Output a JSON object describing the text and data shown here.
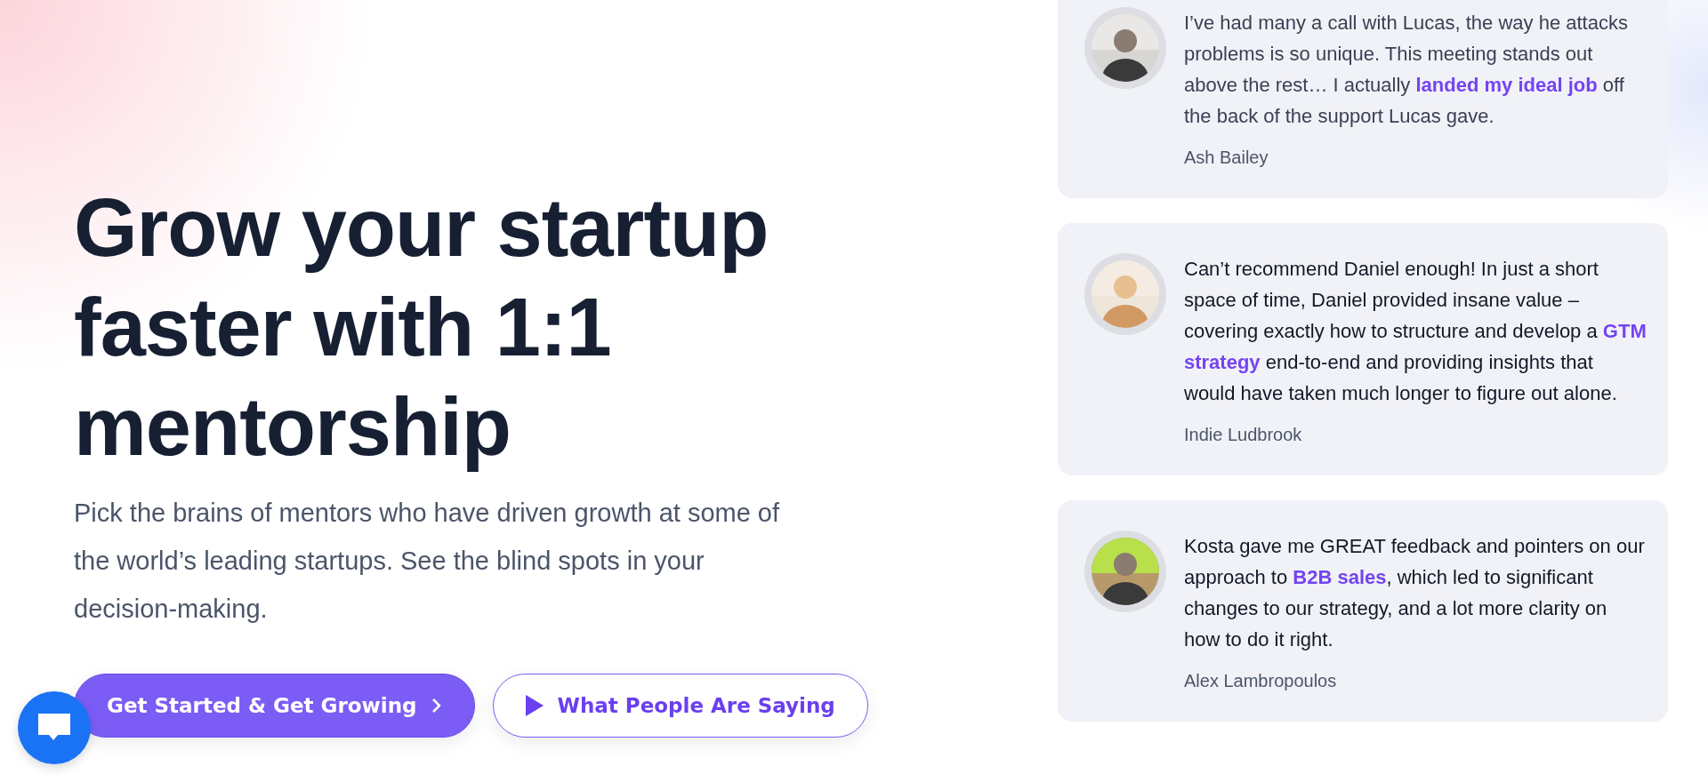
{
  "hero": {
    "title": "Grow your startup faster with 1:1 mentorship",
    "subtitle": "Pick the brains of mentors who have driven growth at some of the world’s leading startups. See the blind spots in your decision-making.",
    "buttons": [
      {
        "kind": "primary",
        "label": "Get Started & Get Growing"
      },
      {
        "kind": "secondary",
        "label": "What People Are Saying"
      }
    ]
  },
  "testimonials": [
    {
      "quote": "I’ve had many a call with Lucas, the way he attacks problems is so unique. This meeting stands out above the rest… I actually **landed my ideal job** off the back of the support Lucas gave.",
      "author": "Ash Bailey"
    },
    {
      "quote": "Can’t recommend Daniel enough! In just a short space of time, Daniel provided insane value – covering exactly how to structure and develop a **GTM strategy** end-to-end and providing insights that would have taken much longer to figure out alone.",
      "author": "Indie Ludbrook"
    },
    {
      "quote": "Kosta gave me GREAT feedback and pointers on our approach to **B2B sales**, which led to significant changes to our strategy, and a lot more clarity on how to do it right.",
      "author": "Alex Lambropoulos"
    }
  ]
}
